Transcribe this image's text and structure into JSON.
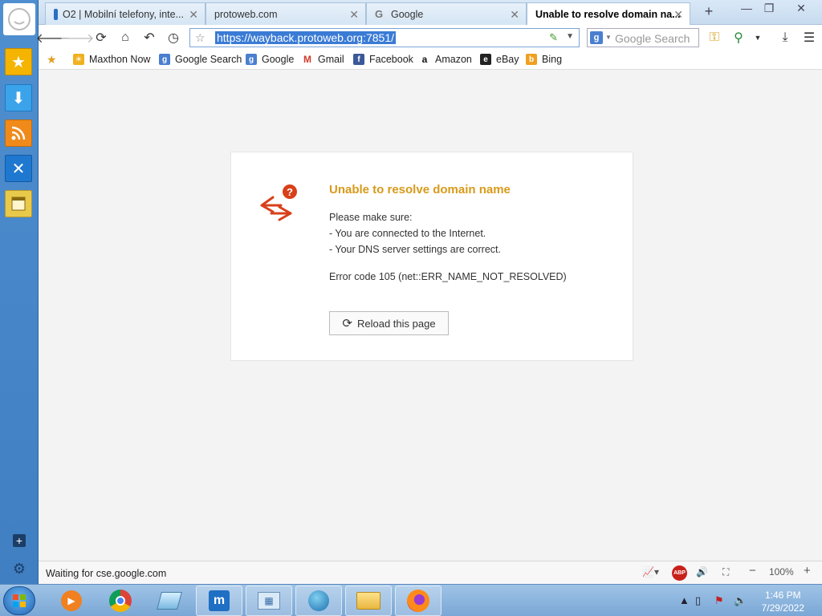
{
  "browser": {
    "tabs": [
      {
        "label": "O2 | Mobilní telefony, inte...",
        "active": false
      },
      {
        "label": "protoweb.com",
        "active": false
      },
      {
        "label": "Google",
        "active": false
      },
      {
        "label": "Unable to resolve domain na...",
        "active": true
      }
    ],
    "url": "https://wayback.protoweb.org:7851/",
    "search_placeholder": "Google Search",
    "bookmarks": [
      {
        "label": "Maxthon Now"
      },
      {
        "label": "Google Search"
      },
      {
        "label": "Google"
      },
      {
        "label": "Gmail"
      },
      {
        "label": "Facebook"
      },
      {
        "label": "Amazon"
      },
      {
        "label": "eBay"
      },
      {
        "label": "Bing"
      }
    ]
  },
  "error_page": {
    "title": "Unable to resolve domain name",
    "intro": "Please make sure:",
    "tips": [
      "- You are connected to the Internet.",
      "- Your DNS server settings are correct."
    ],
    "error_code": "Error code 105 (net::ERR_NAME_NOT_RESOLVED)",
    "reload_label": "Reload this page"
  },
  "status": {
    "text": "Waiting for cse.google.com",
    "zoom": "100%",
    "adblock": "ABP"
  },
  "taskbar": {
    "time": "1:46 PM",
    "date": "7/29/2022"
  },
  "colors": {
    "accent": "#d89a1a",
    "error_icon": "#d8401a",
    "url_highlight": "#3a7bd5"
  }
}
